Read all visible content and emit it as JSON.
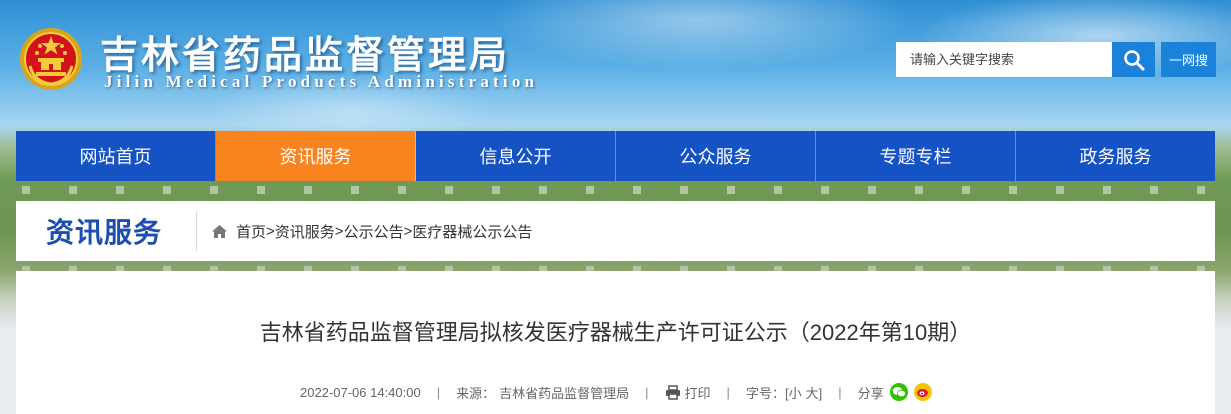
{
  "header": {
    "title": "吉林省药品监督管理局",
    "subtitle": "Jilin Medical Products Administration",
    "search_placeholder": "请输入关键字搜索",
    "one_net_label": "一网搜"
  },
  "nav": {
    "items": [
      {
        "label": "网站首页"
      },
      {
        "label": "资讯服务"
      },
      {
        "label": "信息公开"
      },
      {
        "label": "公众服务"
      },
      {
        "label": "专题专栏"
      },
      {
        "label": "政务服务"
      }
    ],
    "active_index": 1
  },
  "section": {
    "title": "资讯服务",
    "breadcrumb": [
      "首页",
      "资讯服务",
      "公示公告",
      "医疗器械公示公告"
    ],
    "separator": ">"
  },
  "article": {
    "title": "吉林省药品监督管理局拟核发医疗器械生产许可证公示（2022年第10期）",
    "date": "2022-07-06 14:40:00",
    "source_label": "来源：",
    "source": "吉林省药品监督管理局",
    "print_label": "打印",
    "size_label": "字号：",
    "size_small": "[小",
    "size_large": "大]",
    "share_label": "分享",
    "meta_separator": "|"
  },
  "colors": {
    "nav_blue": "#1553c4",
    "nav_active": "#f7841e",
    "search_blue": "#1a82d8",
    "section_title": "#1c4eb0",
    "wechat_green": "#2dc100",
    "weibo_red": "#e6162d"
  },
  "icons": [
    "national-emblem-icon",
    "search-icon",
    "home-icon",
    "printer-icon",
    "wechat-icon",
    "weibo-icon"
  ]
}
